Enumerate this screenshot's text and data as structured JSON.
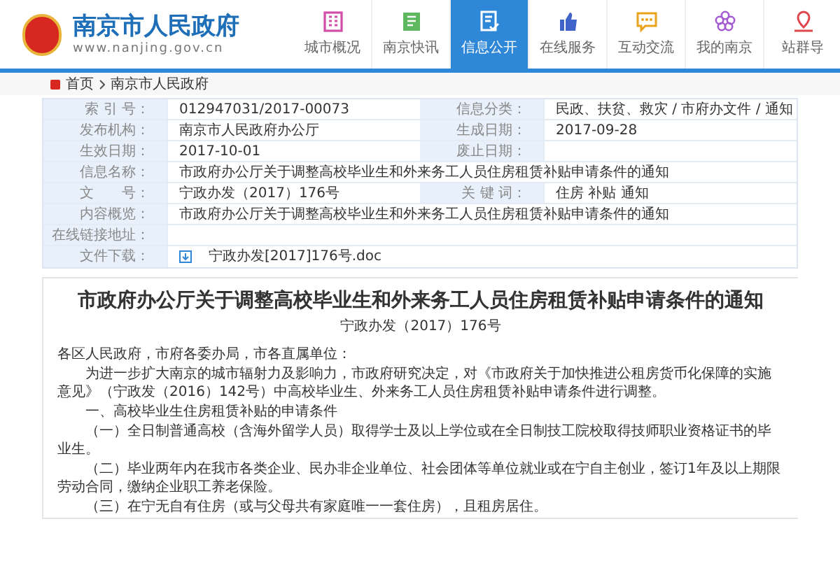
{
  "header": {
    "site_name": "南京市人民政府",
    "site_url": "www.nanjing.gov.cn"
  },
  "nav": [
    {
      "label": "城市概况",
      "selected": false
    },
    {
      "label": "南京快讯",
      "selected": false
    },
    {
      "label": "信息公开",
      "selected": true
    },
    {
      "label": "在线服务",
      "selected": false
    },
    {
      "label": "互动交流",
      "selected": false
    },
    {
      "label": "我的南京",
      "selected": false
    },
    {
      "label": "站群导",
      "selected": false
    }
  ],
  "breadcrumb": [
    "首页",
    "南京市人民政府"
  ],
  "info_table": {
    "rows": [
      {
        "fields": [
          {
            "label": "索 引 号：",
            "value": "012947031/2017-00073"
          },
          {
            "label": "信息分类：",
            "value": "民政、扶贫、救灾 / 市府办文件 / 通知"
          }
        ]
      },
      {
        "fields": [
          {
            "label": "发布机构：",
            "value": "南京市人民政府办公厅"
          },
          {
            "label": "生成日期：",
            "value": "2017-09-28"
          }
        ]
      },
      {
        "fields": [
          {
            "label": "生效日期：",
            "value": "2017-10-01"
          },
          {
            "label": "废止日期："
          }
        ]
      },
      {
        "fields": [
          {
            "label": "信息名称：",
            "value": "市政府办公厅关于调整高校毕业生和外来务工人员住房租赁补贴申请条件的通知"
          }
        ]
      },
      {
        "fields": [
          {
            "label": "文　　号：",
            "value": "宁政办发（2017）176号"
          },
          {
            "label": "关 键 词：",
            "value": "住房 补贴 通知"
          }
        ]
      },
      {
        "fields": [
          {
            "label": "内容概览：",
            "value": "市政府办公厅关于调整高校毕业生和外来务工人员住房租赁补贴申请条件的通知"
          }
        ]
      },
      {
        "fields": [
          {
            "label": "在线链接地址："
          }
        ]
      },
      {
        "fields": [
          {
            "label": "文件下载：",
            "value": "宁政办发[2017]176号.doc",
            "kind": "download"
          }
        ]
      }
    ]
  },
  "article": {
    "title": "市政府办公厅关于调整高校毕业生和外来务工人员住房租赁补贴申请条件的通知",
    "doc_number": "宁政办发（2017）176号",
    "paragraphs": [
      {
        "kind": "salutation",
        "text": "各区人民政府，市府各委办局，市各直属单位："
      },
      {
        "kind": "body",
        "text": "为进一步扩大南京的城市辐射力及影响力，市政府研究决定，对《市政府关于加快推进公租房货币化保障的实施意见》（宁政发（2016）142号）中高校毕业生、外来务工人员住房租赁补贴申请条件进行调整。"
      },
      {
        "kind": "body",
        "text": "一、高校毕业生住房租赁补贴的申请条件"
      },
      {
        "kind": "body",
        "text": "（一）全日制普通高校（含海外留学人员）取得学士及以上学位或在全日制技工院校取得技师职业资格证书的毕业生。"
      },
      {
        "kind": "body",
        "text": "（二）毕业两年内在我市各类企业、民办非企业单位、社会团体等单位就业或在宁自主创业，签订1年及以上期限劳动合同，缴纳企业职工养老保险。"
      },
      {
        "kind": "body",
        "text": "（三）在宁无自有住房（或与父母共有家庭唯一一套住房），且租房居住。"
      }
    ]
  }
}
